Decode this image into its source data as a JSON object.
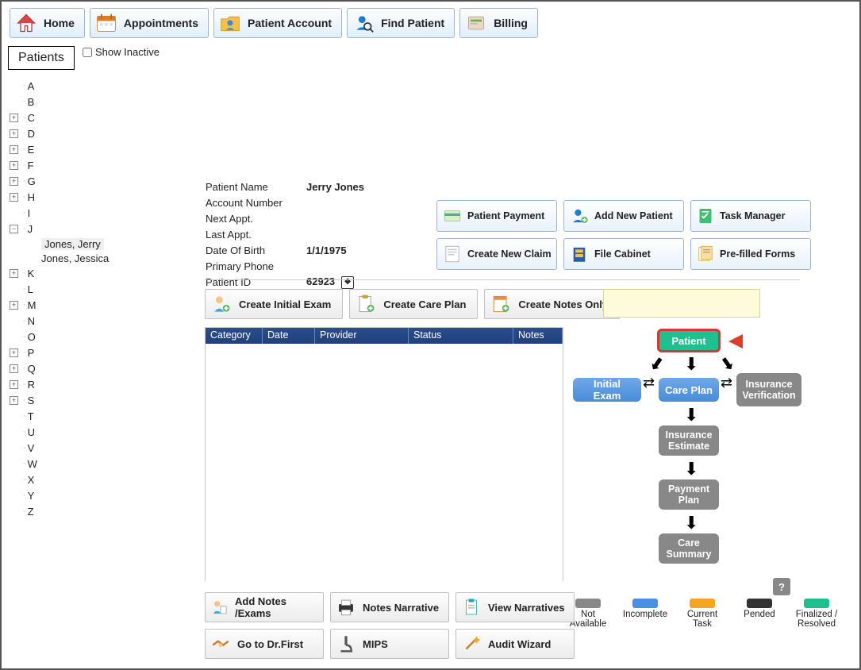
{
  "toolbar": {
    "home": "Home",
    "appointments": "Appointments",
    "patient_account": "Patient Account",
    "find_patient": "Find Patient",
    "billing": "Billing"
  },
  "patients_label": "Patients",
  "show_inactive": "Show Inactive",
  "tree": {
    "letters": [
      "A",
      "B",
      "C",
      "D",
      "E",
      "F",
      "G",
      "H",
      "I",
      "J",
      "K",
      "L",
      "M",
      "N",
      "O",
      "P",
      "Q",
      "R",
      "S",
      "T",
      "U",
      "V",
      "W",
      "X",
      "Y",
      "Z"
    ],
    "expandable": [
      "C",
      "D",
      "E",
      "F",
      "G",
      "H",
      "J",
      "K",
      "M",
      "P",
      "Q",
      "R",
      "S"
    ],
    "expanded": "J",
    "children": [
      {
        "label": "Jones, Jerry",
        "selected": true
      },
      {
        "label": "Jones, Jessica",
        "selected": false
      }
    ]
  },
  "detail": {
    "fields": {
      "patient_name_label": "Patient Name",
      "patient_name": "Jerry  Jones",
      "account_number_label": "Account Number",
      "account_number": "",
      "next_appt_label": "Next Appt.",
      "next_appt": "",
      "last_appt_label": "Last Appt.",
      "last_appt": "",
      "dob_label": "Date Of Birth",
      "dob": "1/1/1975",
      "phone_label": "Primary Phone",
      "phone": "",
      "pid_label": "Patient ID",
      "pid": "62923"
    }
  },
  "actions": {
    "patient_payment": "Patient Payment",
    "add_new_patient": "Add New Patient",
    "task_manager": "Task Manager",
    "create_new_claim": "Create New Claim",
    "file_cabinet": "File Cabinet",
    "prefilled_forms": "Pre-filled Forms"
  },
  "create": {
    "initial_exam": "Create Initial Exam",
    "care_plan": "Create Care Plan",
    "notes_only": "Create Notes Only"
  },
  "grid": {
    "cols": {
      "category": "Category",
      "date": "Date",
      "provider": "Provider",
      "status": "Status",
      "notes": "Notes"
    }
  },
  "flow": {
    "patient": "Patient",
    "initial_exam": "Initial Exam",
    "care_plan": "Care Plan",
    "insurance_verification": "Insurance Verification",
    "insurance_estimate": "Insurance Estimate",
    "payment_plan": "Payment Plan",
    "care_summary": "Care Summary"
  },
  "legend": {
    "not_available": "Not Available",
    "incomplete": "Incomplete",
    "current_task": "Current Task",
    "pended": "Pended",
    "finalized": "Finalized / Resolved",
    "colors": {
      "not_available": "#888",
      "incomplete": "#4a90e2",
      "current_task": "#f5a623",
      "pended": "#333",
      "finalized": "#1fbf8f"
    }
  },
  "help": "?",
  "bottom": {
    "add_notes": "Add Notes /Exams",
    "notes_narrative": "Notes Narrative",
    "view_narratives": "View Narratives",
    "drfirst": "Go to Dr.First",
    "mips": "MIPS",
    "audit_wizard": "Audit Wizard"
  }
}
